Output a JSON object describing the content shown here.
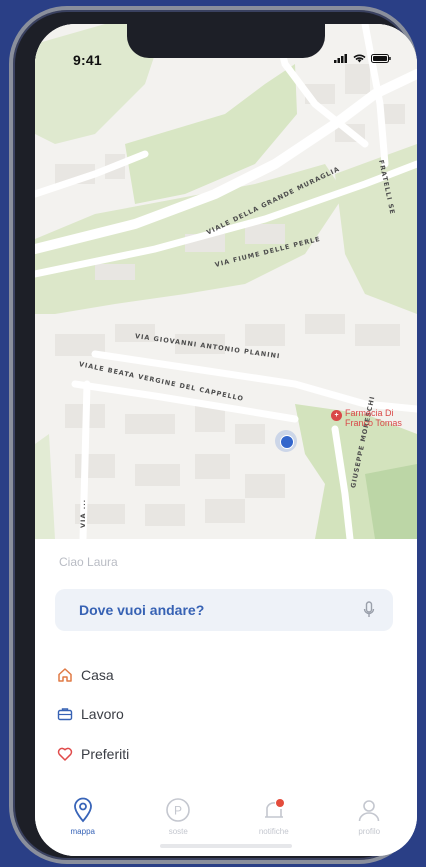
{
  "status_bar": {
    "time": "9:41"
  },
  "map": {
    "streets": [
      "VIALE DELLA GRANDE MURAGLIA",
      "VIA FIUME DELLE PERLE",
      "VIA GIOVANNI ANTONIO PLANINI",
      "VIALE BEATA VERGINE DEL CAPPELLO",
      "FRATELLI SE",
      "GIUSEPPE MORESCHI",
      "VIA ..."
    ],
    "poi": {
      "name_line1": "Farmacia Di",
      "name_line2": "Franco Tomas"
    }
  },
  "sheet": {
    "greeting": "Ciao Laura",
    "search_placeholder": "Dove vuoi andare?",
    "shortcuts": [
      "Casa",
      "Lavoro",
      "Preferiti"
    ]
  },
  "tabbar": {
    "tabs": [
      {
        "label": "mappa",
        "icon": "map-pin-icon",
        "active": true
      },
      {
        "label": "soste",
        "icon": "parking-icon",
        "active": false
      },
      {
        "label": "notifiche",
        "icon": "bell-icon",
        "active": false
      },
      {
        "label": "profilo",
        "icon": "user-icon",
        "active": false
      }
    ]
  },
  "colors": {
    "accent": "#3762b4",
    "alert": "#e44c3c",
    "home_icon": "#e07a45",
    "heart_icon": "#e04a4a"
  }
}
